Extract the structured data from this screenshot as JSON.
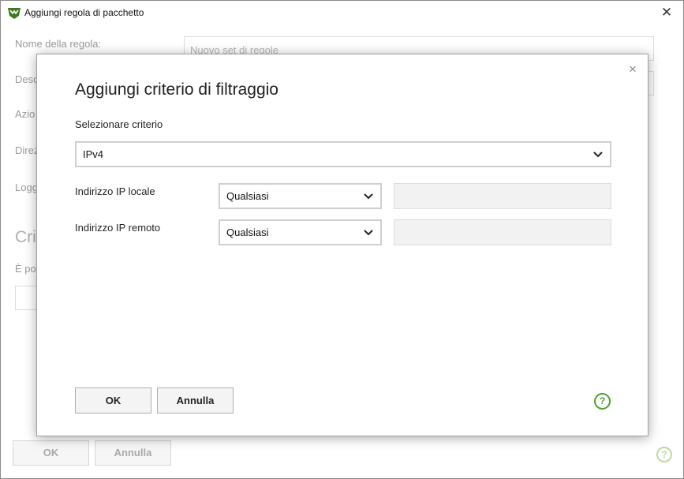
{
  "window": {
    "title": "Aggiungi regola di pacchetto",
    "close_glyph": "✕"
  },
  "background": {
    "labels": [
      "Nome della regola:",
      "Desc",
      "Azio",
      "Direz",
      "Logg"
    ],
    "name_placeholder": "Nuovo set di regole",
    "section_heading": "Crit",
    "section_text": "È po",
    "ok_label": "OK",
    "cancel_label": "Annulla",
    "help_glyph": "?"
  },
  "dialog": {
    "title": "Aggiungi criterio di filtraggio",
    "close_glyph": "×",
    "criterion_label": "Selezionare criterio",
    "criterion_value": "IPv4",
    "rows": [
      {
        "label": "Indirizzo IP locale",
        "value": "Qualsiasi"
      },
      {
        "label": "Indirizzo IP remoto",
        "value": "Qualsiasi"
      }
    ],
    "ok_label": "OK",
    "cancel_label": "Annulla",
    "help_glyph": "?"
  },
  "colors": {
    "accent_green": "#4aa02c",
    "field_border": "#cfcfcf",
    "readonly_bg": "#f2f2f2"
  }
}
